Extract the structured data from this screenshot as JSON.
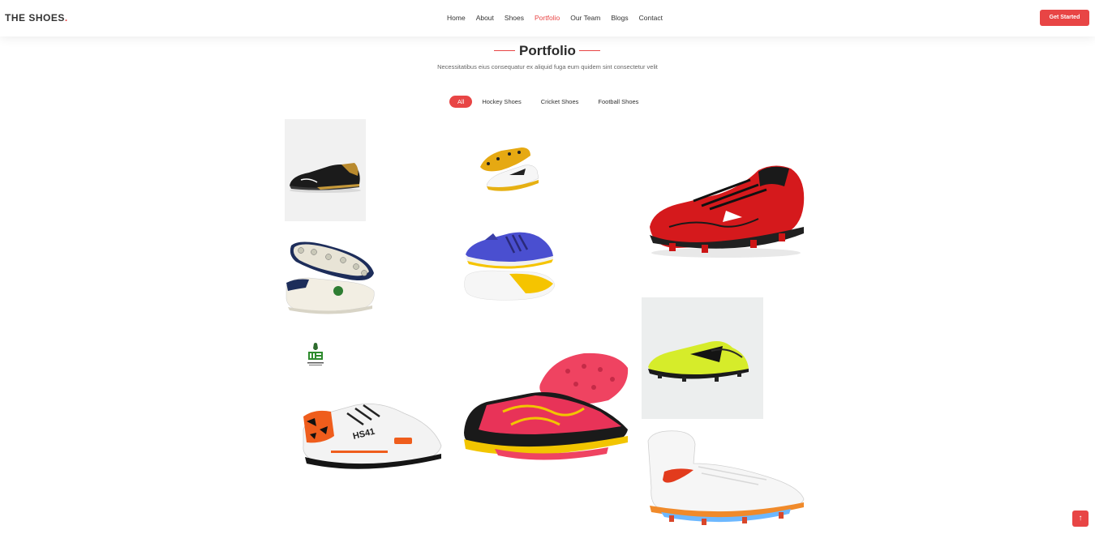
{
  "header": {
    "logo_text": "THE SHOES",
    "logo_dot": ".",
    "nav": [
      "Home",
      "About",
      "Shoes",
      "Portfolio",
      "Our Team",
      "Blogs",
      "Contact"
    ],
    "active_nav": "Portfolio",
    "cta_label": "Get Started"
  },
  "section": {
    "title": "Portfolio",
    "subtitle": "Necessitatibus eius consequatur ex aliquid fuga eum quidem sint consectetur velit"
  },
  "filters": {
    "items": [
      "All",
      "Hockey Shoes",
      "Cricket Shoes",
      "Football Shoes"
    ],
    "active": "All"
  },
  "gallery": [
    {
      "name": "black-gold-running-shoe"
    },
    {
      "name": "white-yellow-cricket-shoe"
    },
    {
      "name": "red-football-boot"
    },
    {
      "name": "cricket-spike-shoe"
    },
    {
      "name": "blue-hockey-shoe"
    },
    {
      "name": "hs-logo"
    },
    {
      "name": "lime-football-boot"
    },
    {
      "name": "orange-camo-cricket-shoe"
    },
    {
      "name": "pink-hockey-shoe"
    },
    {
      "name": "white-high-top-boot"
    }
  ],
  "icons": {
    "back_to_top": "arrow-up-icon"
  },
  "colors": {
    "accent": "#e84545"
  }
}
